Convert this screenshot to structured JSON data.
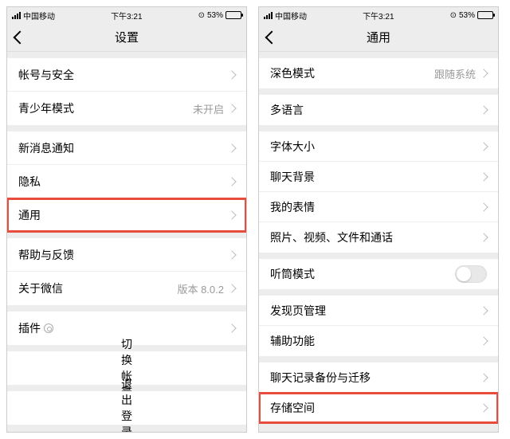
{
  "status": {
    "carrier": "中国移动",
    "time": "下午3:21",
    "battery_pct": "53%"
  },
  "left": {
    "title": "设置",
    "rows": {
      "account": "帐号与安全",
      "teen": "青少年模式",
      "teen_value": "未开启",
      "notify": "新消息通知",
      "privacy": "隐私",
      "general": "通用",
      "help": "帮助与反馈",
      "about": "关于微信",
      "about_value": "版本 8.0.2",
      "plugins": "插件",
      "switch": "切换帐号",
      "logout": "退出登录"
    }
  },
  "right": {
    "title": "通用",
    "rows": {
      "dark": "深色模式",
      "dark_value": "跟随系统",
      "lang": "多语言",
      "font": "字体大小",
      "chatbg": "聊天背景",
      "stickers": "我的表情",
      "media": "照片、视频、文件和通话",
      "earpiece": "听筒模式",
      "discover": "发现页管理",
      "a11y": "辅助功能",
      "backup": "聊天记录备份与迁移",
      "storage": "存储空间"
    }
  }
}
